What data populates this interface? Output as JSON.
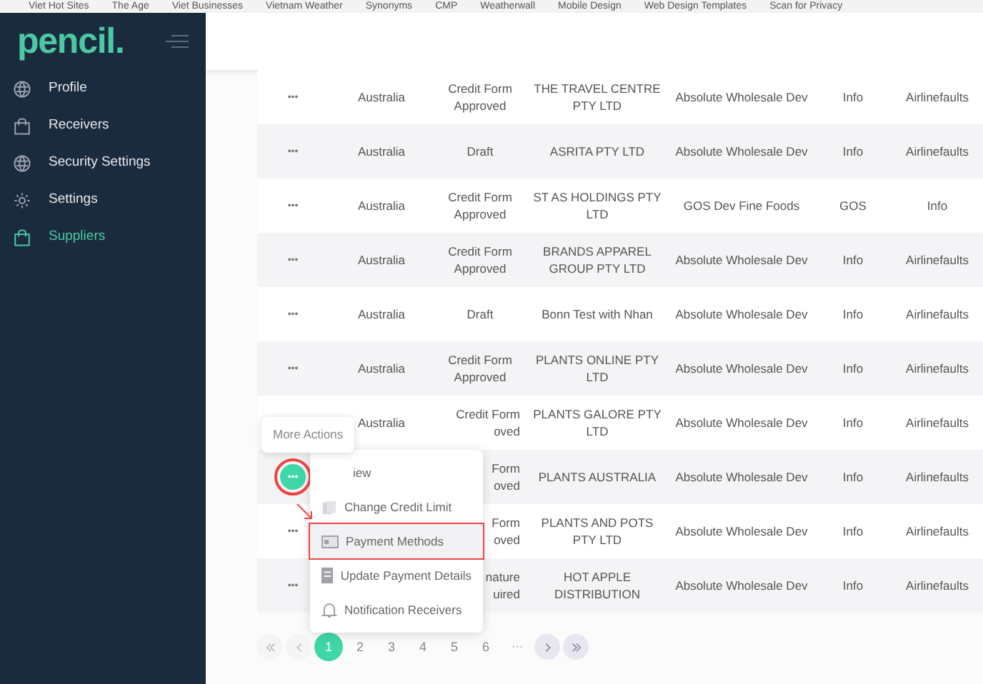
{
  "bookmarks": [
    {
      "label": "Viet Hot Sites"
    },
    {
      "label": "The Age"
    },
    {
      "label": "Viet Businesses"
    },
    {
      "label": "Vietnam Weather"
    },
    {
      "label": "Synonyms"
    },
    {
      "label": "CMP"
    },
    {
      "label": "Weatherwall"
    },
    {
      "label": "Mobile Design"
    },
    {
      "label": "Web Design Templates"
    },
    {
      "label": "Scan for Privacy"
    }
  ],
  "sidebar": {
    "logo": "pencil.",
    "items": [
      {
        "label": "Profile",
        "kind": "globe",
        "selected": false
      },
      {
        "label": "Receivers",
        "kind": "bag",
        "selected": false
      },
      {
        "label": "Security Settings",
        "kind": "globe",
        "selected": false
      },
      {
        "label": "Settings",
        "kind": "gear",
        "selected": false
      },
      {
        "label": "Suppliers",
        "kind": "bag",
        "selected": true
      }
    ]
  },
  "table": {
    "rows": [
      {
        "actions": "•••",
        "country": "Australia",
        "status": [
          "Credit Form",
          "Approved"
        ],
        "name": "THE TRAVEL CENTRE PTY LTD",
        "company": "Absolute Wholesale Dev",
        "column_6": "Info",
        "column_7": "Airlinefaults",
        "covered": false,
        "active": false
      },
      {
        "actions": "•••",
        "country": "Australia",
        "status": [
          "Draft"
        ],
        "name": "ASRITA PTY LTD",
        "company": "Absolute Wholesale Dev",
        "column_6": "Info",
        "column_7": "Airlinefaults",
        "covered": false,
        "active": false
      },
      {
        "actions": "•••",
        "country": "Australia",
        "status": [
          "Credit Form",
          "Approved"
        ],
        "name": "ST AS HOLDINGS PTY LTD",
        "company": "GOS Dev Fine Foods",
        "column_6": "GOS",
        "column_7": "Info",
        "covered": false,
        "active": false
      },
      {
        "actions": "•••",
        "country": "Australia",
        "status": [
          "Credit Form",
          "Approved"
        ],
        "name": "BRANDS APPAREL GROUP PTY LTD",
        "company": "Absolute Wholesale Dev",
        "column_6": "Info",
        "column_7": "Airlinefaults",
        "covered": false,
        "active": false
      },
      {
        "actions": "•••",
        "country": "Australia",
        "status": [
          "Draft"
        ],
        "name": "Bonn Test with Nhan",
        "company": "Absolute Wholesale Dev",
        "column_6": "Info",
        "column_7": "Airlinefaults",
        "covered": false,
        "active": false
      },
      {
        "actions": "•••",
        "country": "Australia",
        "status": [
          "Credit Form",
          "Approved"
        ],
        "name": "PLANTS ONLINE PTY LTD",
        "company": "Absolute Wholesale Dev",
        "column_6": "Info",
        "column_7": "Airlinefaults",
        "covered": false,
        "active": false
      },
      {
        "country": "Australia",
        "status": [
          "Credit Form",
          "oved"
        ],
        "name": "PLANTS GALORE PTY LTD",
        "company": "Absolute Wholesale Dev",
        "column_6": "Info",
        "column_7": "Airlinefaults",
        "covered": true,
        "active": false
      },
      {
        "actions": "•••",
        "status": [
          "Form",
          "oved"
        ],
        "name": "PLANTS AUSTRALIA",
        "company": "Absolute Wholesale Dev",
        "column_6": "Info",
        "column_7": "Airlinefaults",
        "covered": true,
        "active": true
      },
      {
        "actions": "•••",
        "status": [
          "Form",
          "oved"
        ],
        "name": "PLANTS AND POTS PTY LTD",
        "company": "Absolute Wholesale Dev",
        "column_6": "Info",
        "column_7": "Airlinefaults",
        "covered": true,
        "active": false
      },
      {
        "actions": "•••",
        "status": [
          "nature",
          "uired"
        ],
        "name": "HOT APPLE DISTRIBUTION",
        "company": "Absolute Wholesale Dev",
        "column_6": "Info",
        "column_7": "Airlinefaults",
        "covered": true,
        "active": false
      }
    ]
  },
  "tooltip": "More Actions",
  "menu": [
    {
      "label": "iew",
      "kind": "none",
      "selected": false
    },
    {
      "label": "Change Credit Limit",
      "kind": "cards",
      "selected": false
    },
    {
      "label": "Payment Methods",
      "kind": "card",
      "selected": true
    },
    {
      "label": "Update Payment Details",
      "kind": "doc",
      "selected": false
    },
    {
      "label": "Notification Receivers",
      "kind": "bell",
      "selected": false
    }
  ],
  "pagination": {
    "pages": [
      {
        "label": "1",
        "selected": true
      },
      {
        "label": "2",
        "selected": false
      },
      {
        "label": "3",
        "selected": false
      },
      {
        "label": "4",
        "selected": false
      },
      {
        "label": "5",
        "selected": false
      },
      {
        "label": "6",
        "selected": false
      }
    ],
    "ellipsis": "···"
  }
}
